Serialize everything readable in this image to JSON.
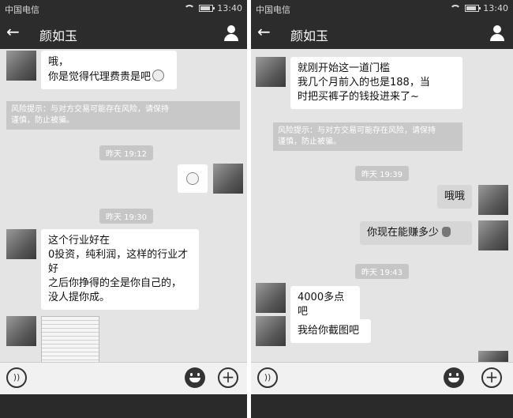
{
  "status": {
    "carrier": "中国电信",
    "time": "13:40"
  },
  "chat": {
    "contact_name": "颜如玉"
  },
  "left": {
    "msg1": "哦，\n你是觉得代理费贵是吧",
    "risk": "风险提示：与对方交易可能存在风险，请保持\n谨慎，防止被骗。",
    "time1": "昨天 19:12",
    "time2": "昨天 19:30",
    "msg2": "这个行业好在\n0投资，纯利润，这样的行业才\n好\n之后你挣得的全是你自己的，\n没人提你成。"
  },
  "right": {
    "msg1": "就刚开始这一道门槛\n我几个月前入的也是188，当\n时把买裤子的钱投进来了~",
    "risk": "风险提示：与对方交易可能存在风险，请保持\n谨慎，防止被骗。",
    "time1": "昨天 19:39",
    "msg_me1": "哦哦",
    "msg_me2": "你现在能赚多少",
    "time2": "昨天 19:43",
    "msg2": "4000多点吧",
    "msg3": "我给你截图吧"
  }
}
